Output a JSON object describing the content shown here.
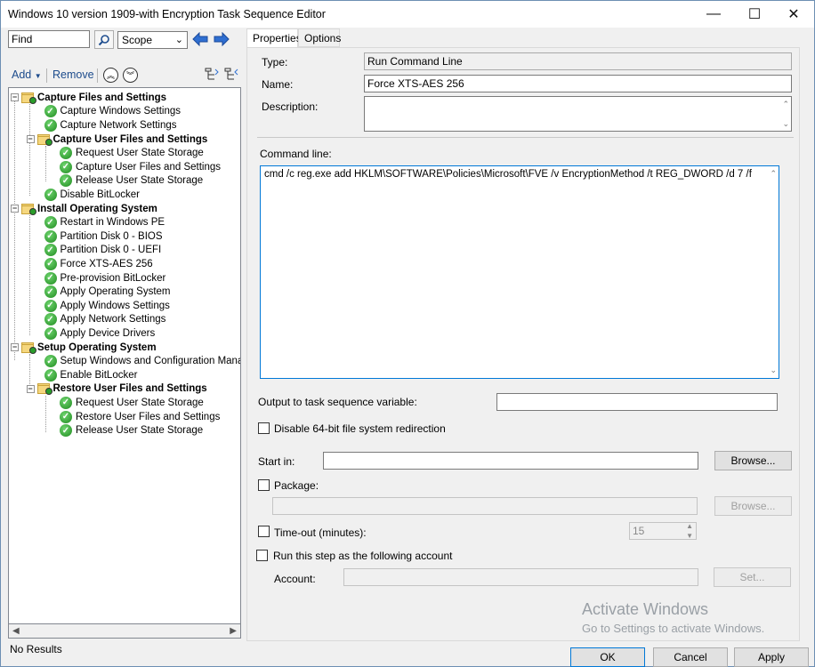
{
  "window": {
    "title": "Windows 10 version 1909-with Encryption Task Sequence Editor",
    "minimize": "—",
    "maximize": "☐",
    "close": "✕"
  },
  "search": {
    "find_value": "Find",
    "scope_value": "Scope"
  },
  "toolbar": {
    "add_label": "Add",
    "remove_label": "Remove"
  },
  "tree": [
    {
      "label": "Capture Files and Settings",
      "level": 0,
      "type": "group"
    },
    {
      "label": "Capture Windows Settings",
      "level": 1,
      "type": "step"
    },
    {
      "label": "Capture Network Settings",
      "level": 1,
      "type": "step"
    },
    {
      "label": "Capture User Files and Settings",
      "level": 1,
      "type": "group"
    },
    {
      "label": "Request User State Storage",
      "level": 2,
      "type": "step"
    },
    {
      "label": "Capture User Files and Settings",
      "level": 2,
      "type": "step"
    },
    {
      "label": "Release User State Storage",
      "level": 2,
      "type": "step"
    },
    {
      "label": "Disable BitLocker",
      "level": 1,
      "type": "step"
    },
    {
      "label": "Install Operating System",
      "level": 0,
      "type": "group"
    },
    {
      "label": "Restart in Windows PE",
      "level": 1,
      "type": "step"
    },
    {
      "label": "Partition Disk 0 - BIOS",
      "level": 1,
      "type": "step"
    },
    {
      "label": "Partition Disk 0 - UEFI",
      "level": 1,
      "type": "step"
    },
    {
      "label": "Force XTS-AES 256",
      "level": 1,
      "type": "step"
    },
    {
      "label": "Pre-provision BitLocker",
      "level": 1,
      "type": "step"
    },
    {
      "label": "Apply Operating System",
      "level": 1,
      "type": "step"
    },
    {
      "label": "Apply Windows Settings",
      "level": 1,
      "type": "step"
    },
    {
      "label": "Apply Network Settings",
      "level": 1,
      "type": "step"
    },
    {
      "label": "Apply Device Drivers",
      "level": 1,
      "type": "step"
    },
    {
      "label": "Setup Operating System",
      "level": 0,
      "type": "group"
    },
    {
      "label": "Setup Windows and Configuration Manager",
      "level": 1,
      "type": "step"
    },
    {
      "label": "Enable BitLocker",
      "level": 1,
      "type": "step"
    },
    {
      "label": "Restore User Files and Settings",
      "level": 1,
      "type": "group"
    },
    {
      "label": "Request User State Storage",
      "level": 2,
      "type": "step"
    },
    {
      "label": "Restore User Files and Settings",
      "level": 2,
      "type": "step"
    },
    {
      "label": "Release User State Storage",
      "level": 2,
      "type": "step"
    }
  ],
  "status_text": "No Results",
  "tabs": {
    "properties": "Properties",
    "options": "Options"
  },
  "props": {
    "type_label": "Type:",
    "type_value": "Run Command Line",
    "name_label": "Name:",
    "name_value": "Force XTS-AES 256",
    "description_label": "Description:",
    "description_value": "",
    "command_label": "Command line:",
    "command_value": "cmd /c reg.exe add HKLM\\SOFTWARE\\Policies\\Microsoft\\FVE /v EncryptionMethod /t REG_DWORD /d 7 /f",
    "output_label": "Output to task sequence variable:",
    "output_value": "",
    "disable64_label": "Disable 64-bit file system redirection",
    "startin_label": "Start in:",
    "startin_value": "",
    "browse_label": "Browse...",
    "package_label": "Package:",
    "package_value": "",
    "browse2_label": "Browse...",
    "timeout_label": "Time-out (minutes):",
    "timeout_value": "15",
    "runas_label": "Run this step as the following account",
    "account_label": "Account:",
    "account_value": "",
    "set_label": "Set..."
  },
  "buttons": {
    "ok": "OK",
    "cancel": "Cancel",
    "apply": "Apply"
  },
  "watermark": {
    "line1": "Activate Windows",
    "line2": "Go to Settings to activate Windows."
  }
}
